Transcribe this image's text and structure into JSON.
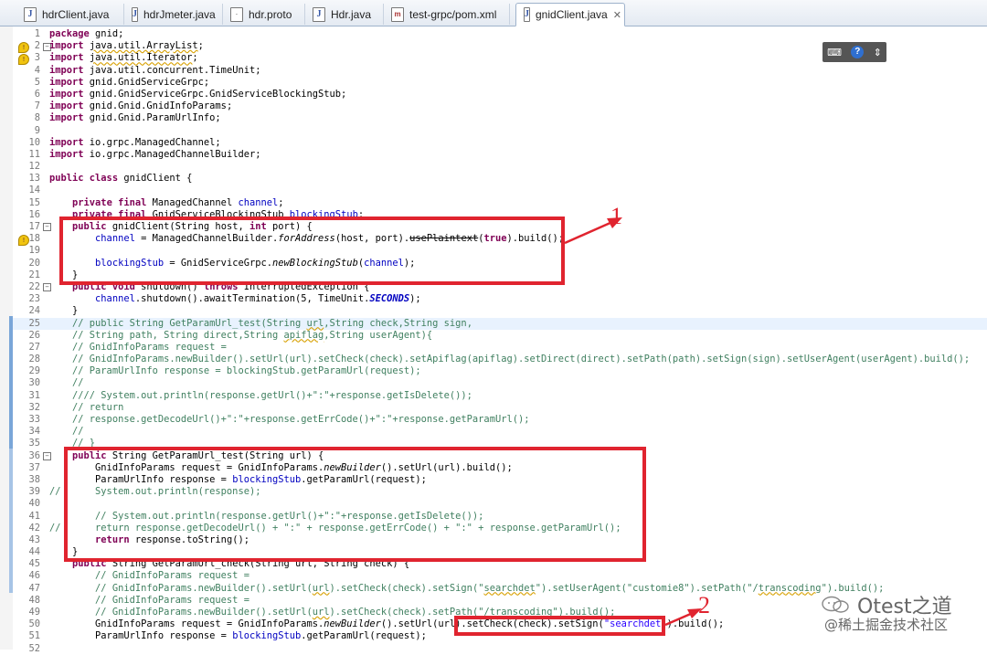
{
  "tabs": [
    {
      "label": "hdrClient.java",
      "icon": "java-file-icon"
    },
    {
      "label": "hdrJmeter.java",
      "icon": "java-file-icon"
    },
    {
      "label": "hdr.proto",
      "icon": "text-file-icon"
    },
    {
      "label": "Hdr.java",
      "icon": "java-file-icon"
    },
    {
      "label": "test-grpc/pom.xml",
      "icon": "maven-file-icon"
    },
    {
      "label": "gnidClient.java",
      "icon": "java-file-icon",
      "active": true
    }
  ],
  "tab_close_glyph": "✕",
  "toolbar": {
    "keyboard_glyph": "⌨",
    "help_glyph": "?"
  },
  "code_lines": [
    {
      "n": "1",
      "t": "package gnid;"
    },
    {
      "n": "2",
      "t": "import java.util.ArrayList;"
    },
    {
      "n": "3",
      "t": "import java.util.Iterator;"
    },
    {
      "n": "4",
      "t": "import java.util.concurrent.TimeUnit;"
    },
    {
      "n": "5",
      "t": "import gnid.GnidServiceGrpc;"
    },
    {
      "n": "6",
      "t": "import gnid.GnidServiceGrpc.GnidServiceBlockingStub;"
    },
    {
      "n": "7",
      "t": "import gnid.Gnid.GnidInfoParams;"
    },
    {
      "n": "8",
      "t": "import gnid.Gnid.ParamUrlInfo;"
    },
    {
      "n": "9",
      "t": ""
    },
    {
      "n": "10",
      "t": "import io.grpc.ManagedChannel;"
    },
    {
      "n": "11",
      "t": "import io.grpc.ManagedChannelBuilder;"
    },
    {
      "n": "12",
      "t": ""
    },
    {
      "n": "13",
      "t": "public class gnidClient {"
    },
    {
      "n": "14",
      "t": ""
    },
    {
      "n": "15",
      "t": "    private final ManagedChannel channel;"
    },
    {
      "n": "16",
      "t": "    private final GnidServiceBlockingStub blockingStub;"
    },
    {
      "n": "17",
      "t": "    public gnidClient(String host, int port) {"
    },
    {
      "n": "18",
      "t": "        channel = ManagedChannelBuilder.forAddress(host, port).usePlaintext(true).build();"
    },
    {
      "n": "19",
      "t": ""
    },
    {
      "n": "20",
      "t": "        blockingStub = GnidServiceGrpc.newBlockingStub(channel);"
    },
    {
      "n": "21",
      "t": "    }"
    },
    {
      "n": "22",
      "t": "    public void shutdown() throws InterruptedException {"
    },
    {
      "n": "23",
      "t": "        channel.shutdown().awaitTermination(5, TimeUnit.SECONDS);"
    },
    {
      "n": "24",
      "t": "    }"
    },
    {
      "n": "25",
      "t": "    // public String GetParamUrl_test(String url,String check,String sign,"
    },
    {
      "n": "26",
      "t": "    // String path, String direct,String apiflag,String userAgent){"
    },
    {
      "n": "27",
      "t": "    // GnidInfoParams request ="
    },
    {
      "n": "28",
      "t": "    // GnidInfoParams.newBuilder().setUrl(url).setCheck(check).setApiflag(apiflag).setDirect(direct).setPath(path).setSign(sign).setUserAgent(userAgent).build();"
    },
    {
      "n": "29",
      "t": "    // ParamUrlInfo response = blockingStub.getParamUrl(request);"
    },
    {
      "n": "30",
      "t": "    //"
    },
    {
      "n": "31",
      "t": "    //// System.out.println(response.getUrl()+\":\"+response.getIsDelete());"
    },
    {
      "n": "32",
      "t": "    // return"
    },
    {
      "n": "33",
      "t": "    // response.getDecodeUrl()+\":\"+response.getErrCode()+\":\"+response.getParamUrl();"
    },
    {
      "n": "34",
      "t": "    //"
    },
    {
      "n": "35",
      "t": "    // }"
    },
    {
      "n": "36",
      "t": "    public String GetParamUrl_test(String url) {"
    },
    {
      "n": "37",
      "t": "        GnidInfoParams request = GnidInfoParams.newBuilder().setUrl(url).build();"
    },
    {
      "n": "38",
      "t": "        ParamUrlInfo response = blockingStub.getParamUrl(request);"
    },
    {
      "n": "39",
      "t": "//      System.out.println(response);"
    },
    {
      "n": "40",
      "t": ""
    },
    {
      "n": "41",
      "t": "        // System.out.println(response.getUrl()+\":\"+response.getIsDelete());"
    },
    {
      "n": "42",
      "t": "//      return response.getDecodeUrl() + \":\" + response.getErrCode() + \":\" + response.getParamUrl();"
    },
    {
      "n": "43",
      "t": "        return response.toString();"
    },
    {
      "n": "44",
      "t": "    }"
    },
    {
      "n": "45",
      "t": "    public String GetParamUrl_check(String url, String check) {"
    },
    {
      "n": "46",
      "t": "        // GnidInfoParams request ="
    },
    {
      "n": "47",
      "t": "        // GnidInfoParams.newBuilder().setUrl(url).setCheck(check).setSign(\"searchdet\").setUserAgent(\"customie8\").setPath(\"/transcoding\").build();"
    },
    {
      "n": "48",
      "t": "        // GnidInfoParams request ="
    },
    {
      "n": "49",
      "t": "        // GnidInfoParams.newBuilder().setUrl(url).setCheck(check).setPath(\"/transcoding\").build();"
    },
    {
      "n": "50",
      "t": "        GnidInfoParams request = GnidInfoParams.newBuilder().setUrl(url).setCheck(check).setSign(\"searchdet\").build();"
    },
    {
      "n": "51",
      "t": "        ParamUrlInfo response = blockingStub.getParamUrl(request);"
    },
    {
      "n": "52",
      "t": ""
    }
  ],
  "annotations": [
    {
      "label": "1"
    },
    {
      "label": "2"
    }
  ],
  "watermark": {
    "brand": "Otest之道",
    "site": "@稀土掘金技术社区"
  },
  "colors": {
    "keyword": "#7f0055",
    "field": "#0000c0",
    "comment": "#3f7f5f",
    "string": "#2a00ff",
    "annotation_red": "#e0242f"
  }
}
